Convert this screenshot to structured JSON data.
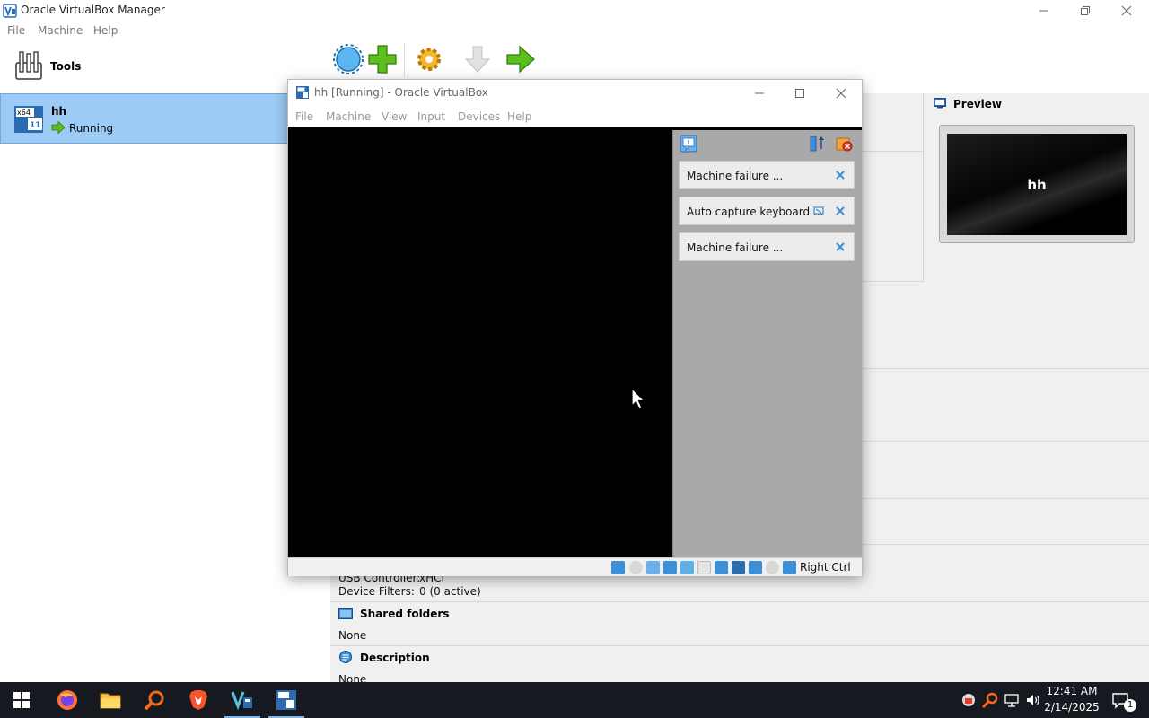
{
  "manager": {
    "title": "Oracle VirtualBox Manager",
    "menu": [
      "File",
      "Machine",
      "Help"
    ],
    "tools_label": "Tools",
    "vm": {
      "name": "hh",
      "state": "Running"
    },
    "preview": {
      "title": "Preview",
      "vm_name": "hh"
    },
    "details": {
      "usb_controller_label": "USB Controller:",
      "usb_controller_value": "xHCI",
      "device_filters_label": "Device Filters:",
      "device_filters_value": "0 (0 active)",
      "shared_folders_title": "Shared folders",
      "shared_folders_value": "None",
      "description_title": "Description",
      "description_value": "None"
    }
  },
  "vm_window": {
    "title": "hh [Running] - Oracle VirtualBox",
    "menu": [
      "File",
      "Machine",
      "View",
      "Input",
      "Devices",
      "Help"
    ],
    "notifications": [
      {
        "text": "Machine failure ..."
      },
      {
        "text": "Auto capture keyboard ..."
      },
      {
        "text": "Machine failure ..."
      }
    ],
    "host_key": "Right Ctrl"
  },
  "taskbar": {
    "apps": [
      "start-icon",
      "firefox-icon",
      "file-explorer-icon",
      "search-app-icon",
      "brave-icon",
      "virtualbox-icon",
      "vm-window-icon"
    ],
    "time": "12:41 AM",
    "date": "2/14/2025",
    "notification_count": "1"
  },
  "colors": {
    "selection": "#9ccbf5",
    "taskbar": "#161a20",
    "notification_panel": "#a9a9a9",
    "accent_green": "#5cc01c",
    "accent_blue": "#3d8fd6"
  }
}
